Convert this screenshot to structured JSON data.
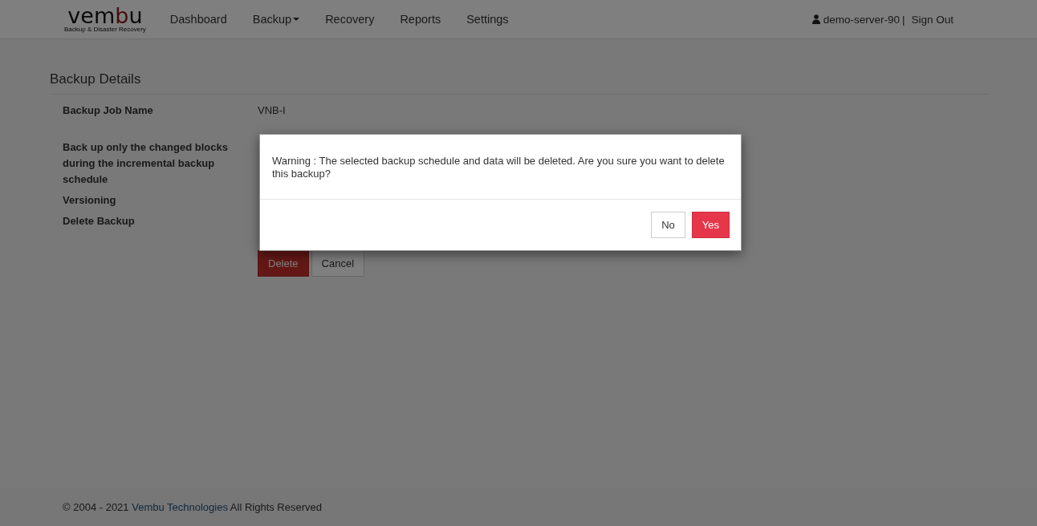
{
  "navbar": {
    "logo": {
      "parts": [
        {
          "text": "vem",
          "accent": false
        },
        {
          "text": "b",
          "accent": true
        },
        {
          "text": "u",
          "accent": false
        }
      ],
      "tagline": "Backup & Disaster Recovery"
    },
    "items": [
      {
        "label": "Dashboard",
        "dropdown": false
      },
      {
        "label": "Backup",
        "dropdown": true
      },
      {
        "label": "Recovery",
        "dropdown": false
      },
      {
        "label": "Reports",
        "dropdown": false
      },
      {
        "label": "Settings",
        "dropdown": false
      }
    ],
    "user": "demo-server-90",
    "separator": "|",
    "sign_out": "Sign Out"
  },
  "details": {
    "title": "Backup Details",
    "rows": [
      {
        "label": "Backup Job Name",
        "value": "VNB-I"
      },
      {
        "label": "Back up only the changed blocks during the incremental backup schedule"
      },
      {
        "label": "Versioning"
      },
      {
        "label": "Delete Backup"
      }
    ],
    "buttons": [
      {
        "label": "Delete",
        "kind": "danger"
      },
      {
        "label": "Cancel",
        "kind": "default"
      }
    ]
  },
  "dialog": {
    "message": "Warning : The selected backup schedule and data will be deleted. Are you sure you want to delete this backup?",
    "buttons": [
      {
        "label": "No",
        "kind": "default"
      },
      {
        "label": "Yes",
        "kind": "danger"
      }
    ]
  },
  "footer": {
    "before": "© 2004 - 2021 ",
    "link": "Vembu Technologies",
    "after": " All Rights Reserved"
  }
}
